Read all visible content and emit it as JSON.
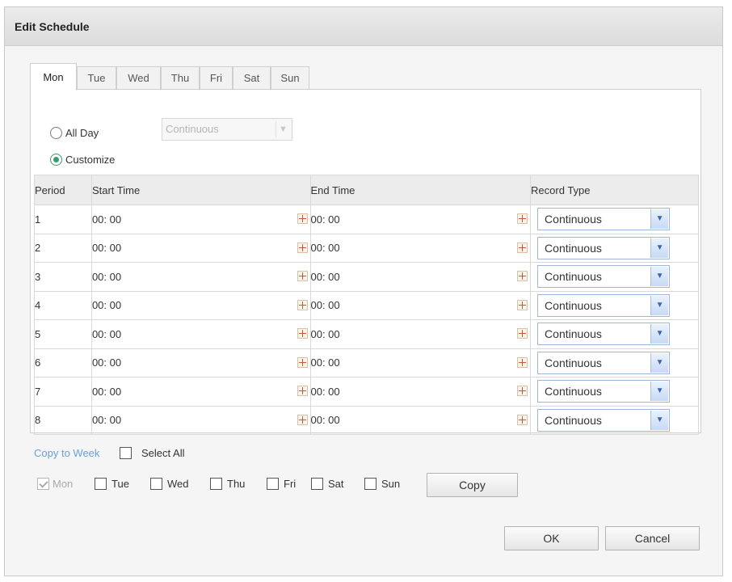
{
  "dialog": {
    "title": "Edit Schedule"
  },
  "tabs": [
    {
      "label": "Mon",
      "active": true
    },
    {
      "label": "Tue",
      "active": false
    },
    {
      "label": "Wed",
      "active": false
    },
    {
      "label": "Thu",
      "active": false
    },
    {
      "label": "Fri",
      "active": false
    },
    {
      "label": "Sat",
      "active": false
    },
    {
      "label": "Sun",
      "active": false
    }
  ],
  "mode": {
    "all_day_label": "All Day",
    "customize_label": "Customize",
    "selected": "Customize",
    "all_day_type_value": "Continuous"
  },
  "table": {
    "headers": {
      "period": "Period",
      "start": "Start Time",
      "end": "End Time",
      "type": "Record Type"
    },
    "rows": [
      {
        "period": "1",
        "start": "00: 00",
        "end": "00: 00",
        "type": "Continuous"
      },
      {
        "period": "2",
        "start": "00: 00",
        "end": "00: 00",
        "type": "Continuous"
      },
      {
        "period": "3",
        "start": "00: 00",
        "end": "00: 00",
        "type": "Continuous"
      },
      {
        "period": "4",
        "start": "00: 00",
        "end": "00: 00",
        "type": "Continuous"
      },
      {
        "period": "5",
        "start": "00: 00",
        "end": "00: 00",
        "type": "Continuous"
      },
      {
        "period": "6",
        "start": "00: 00",
        "end": "00: 00",
        "type": "Continuous"
      },
      {
        "period": "7",
        "start": "00: 00",
        "end": "00: 00",
        "type": "Continuous"
      },
      {
        "period": "8",
        "start": "00: 00",
        "end": "00: 00",
        "type": "Continuous"
      }
    ]
  },
  "copy": {
    "link_label": "Copy to Week",
    "select_all_label": "Select All",
    "days": [
      {
        "label": "Mon",
        "checked": true,
        "disabled": true
      },
      {
        "label": "Tue",
        "checked": false,
        "disabled": false
      },
      {
        "label": "Wed",
        "checked": false,
        "disabled": false
      },
      {
        "label": "Thu",
        "checked": false,
        "disabled": false
      },
      {
        "label": "Fri",
        "checked": false,
        "disabled": false
      },
      {
        "label": "Sat",
        "checked": false,
        "disabled": false
      },
      {
        "label": "Sun",
        "checked": false,
        "disabled": false
      }
    ],
    "copy_button": "Copy"
  },
  "footer": {
    "ok_label": "OK",
    "cancel_label": "Cancel"
  },
  "colors": {
    "accent": "#3c9b6a",
    "link": "#6a9fd8",
    "select_border": "#9fb6d9"
  }
}
